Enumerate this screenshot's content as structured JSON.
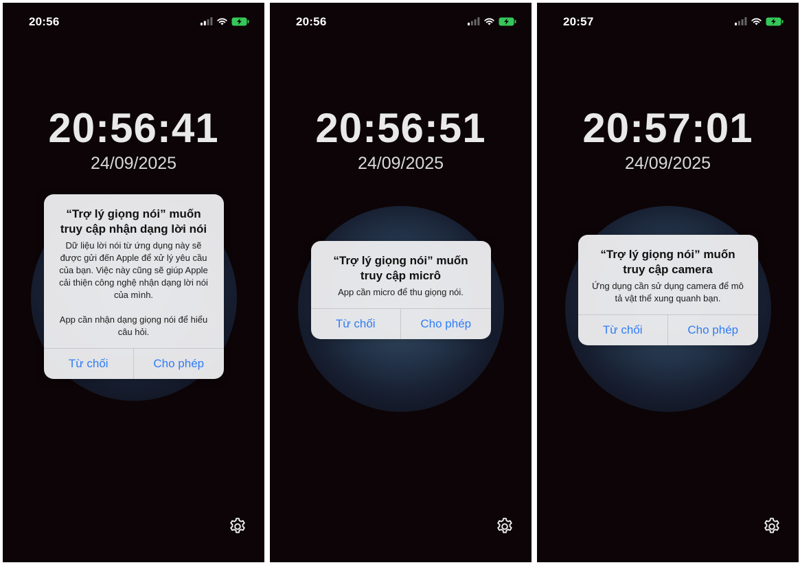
{
  "screens": [
    {
      "status_time": "20:56",
      "clock": "20:56:41",
      "date": "24/09/2025",
      "alert": {
        "title": "“Trợ lý giọng nói” muốn truy cập nhận dạng lời nói",
        "message": "Dữ liệu lời nói từ ứng dụng này sẽ được gửi đến Apple để xử lý yêu cầu của bạn. Việc này cũng sẽ giúp Apple cải thiện công nghệ nhận dạng lời nói của mình.\n\nApp cần nhận dạng giọng nói để hiểu câu hỏi.",
        "deny_label": "Từ chối",
        "allow_label": "Cho phép"
      }
    },
    {
      "status_time": "20:56",
      "clock": "20:56:51",
      "date": "24/09/2025",
      "alert": {
        "title": "“Trợ lý giọng nói” muốn truy cập micrô",
        "message": "App cần micro để thu giọng nói.",
        "deny_label": "Từ chối",
        "allow_label": "Cho phép"
      }
    },
    {
      "status_time": "20:57",
      "clock": "20:57:01",
      "date": "24/09/2025",
      "alert": {
        "title": "“Trợ lý giọng nói” muốn truy cập camera",
        "message": "Ứng dụng cần sử dụng camera để mô tả vật thể xung quanh bạn.",
        "deny_label": "Từ chối",
        "allow_label": "Cho phép"
      }
    }
  ],
  "icons": {
    "signal": "cellular-signal-icon",
    "wifi": "wifi-icon",
    "battery": "battery-charging-icon",
    "settings": "gear-icon"
  },
  "colors": {
    "background": "#0c0406",
    "alert_button": "#2f7cf6",
    "battery": "#35c759"
  }
}
